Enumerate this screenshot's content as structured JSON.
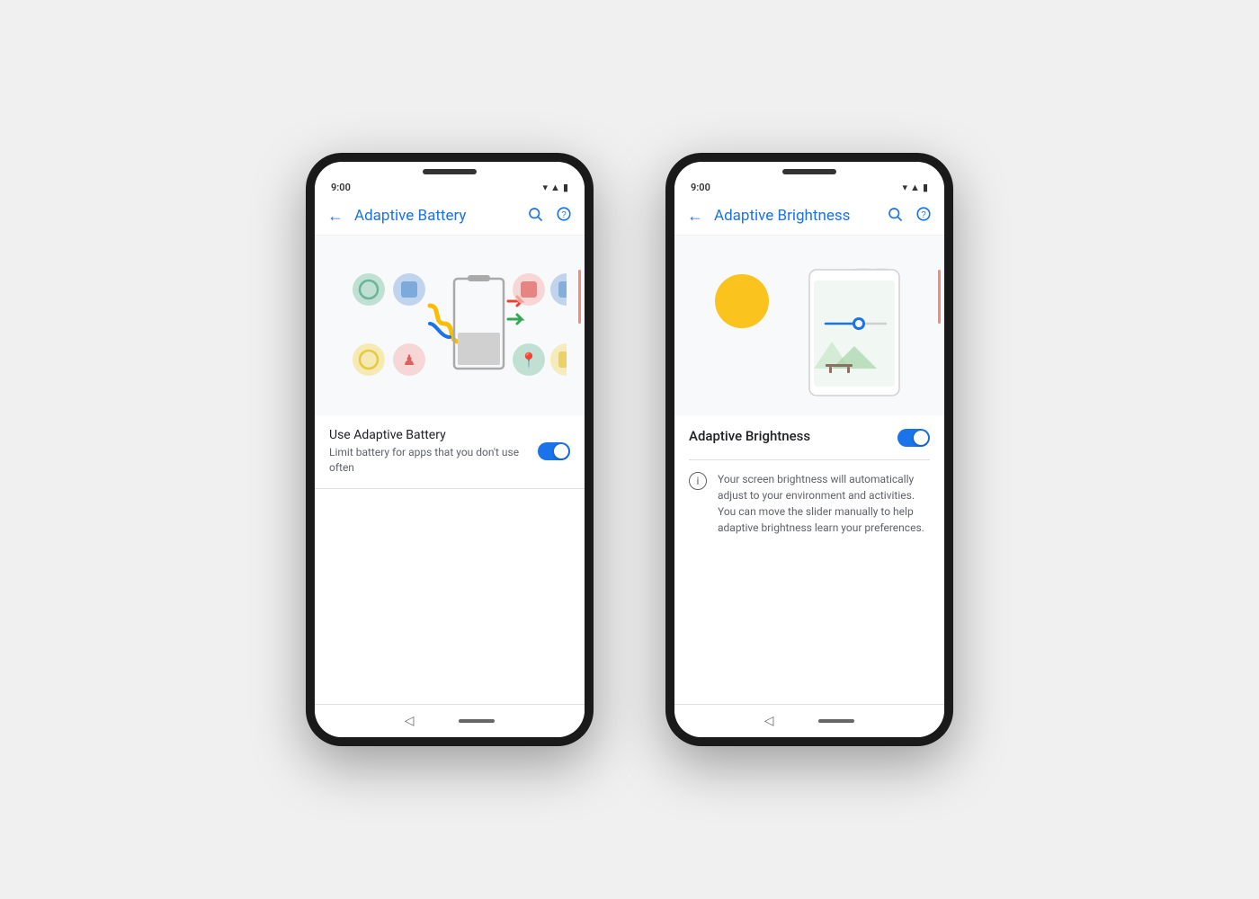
{
  "page": {
    "background": "#f0f0f0"
  },
  "phone1": {
    "time": "9:00",
    "app_bar": {
      "back_icon": "←",
      "title": "Adaptive Battery",
      "search_icon": "🔍",
      "help_icon": "?"
    },
    "setting": {
      "title": "Use Adaptive Battery",
      "description": "Limit battery for apps that you don't use often",
      "toggle_state": "on"
    },
    "nav": {
      "back_label": "◁",
      "home_bar": ""
    }
  },
  "phone2": {
    "time": "9:00",
    "app_bar": {
      "back_icon": "←",
      "title": "Adaptive Brightness",
      "search_icon": "🔍",
      "help_icon": "?"
    },
    "setting": {
      "title": "Adaptive Brightness",
      "toggle_state": "on"
    },
    "info_text": "Your screen brightness will automatically adjust to your environment and activities. You can move the slider manually to help adaptive brightness learn your preferences.",
    "nav": {
      "back_label": "◁",
      "home_bar": ""
    }
  }
}
